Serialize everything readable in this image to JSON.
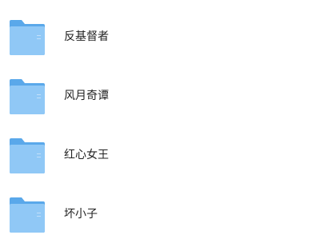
{
  "folders": [
    {
      "name": "反基督者",
      "icon": "folder-icon"
    },
    {
      "name": "风月奇谭",
      "icon": "folder-icon"
    },
    {
      "name": "红心女王",
      "icon": "folder-icon"
    },
    {
      "name": "坏小子",
      "icon": "folder-icon"
    }
  ],
  "colors": {
    "folder_back": "#5aa8ea",
    "folder_front": "#90c8f6",
    "text": "#222222"
  }
}
